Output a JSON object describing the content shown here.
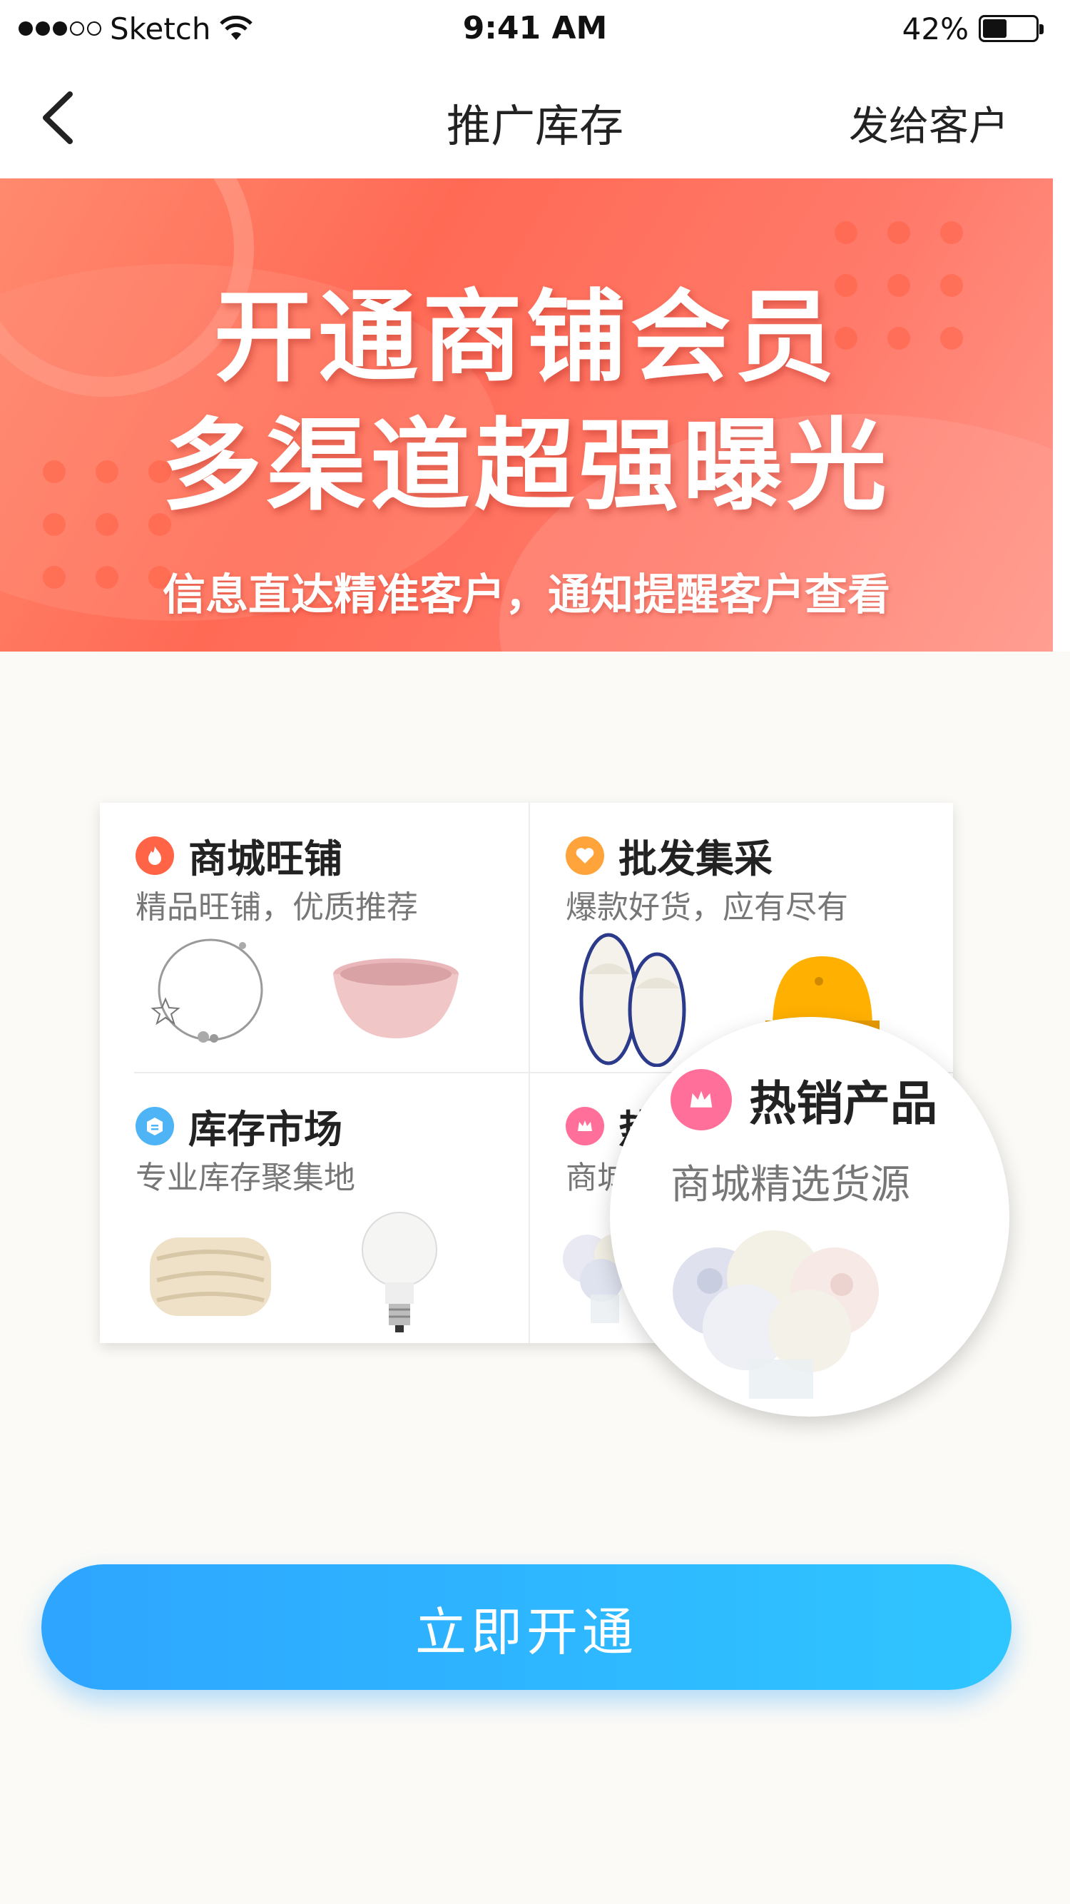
{
  "status_bar": {
    "carrier": "Sketch",
    "time": "9:41 AM",
    "battery_percent": "42%"
  },
  "nav": {
    "title": "推广库存",
    "action": "发给客户"
  },
  "banner": {
    "title_line1": "开通商铺会员",
    "title_line2": "多渠道超强曝光",
    "subtitle": "信息直达精准客户，通知提醒客户查看"
  },
  "features": [
    {
      "title": "商城旺铺",
      "subtitle": "精品旺铺，优质推荐",
      "icon": "flame-icon",
      "color": "#ff6446"
    },
    {
      "title": "批发集采",
      "subtitle": "爆款好货，应有尽有",
      "icon": "heart-icon",
      "color": "#ffa43a"
    },
    {
      "title": "库存市场",
      "subtitle": "专业库存聚集地",
      "icon": "box-icon",
      "color": "#4eb4f5"
    },
    {
      "title": "热",
      "subtitle": "商城",
      "icon": "crown-icon",
      "color": "#ff6f9a"
    }
  ],
  "highlight": {
    "title": "热销产品",
    "subtitle": "商城精选货源",
    "icon": "crown-icon"
  },
  "cta": {
    "label": "立即开通"
  },
  "colors": {
    "banner": "#ff6a55",
    "cta": "#2ea5ff"
  }
}
